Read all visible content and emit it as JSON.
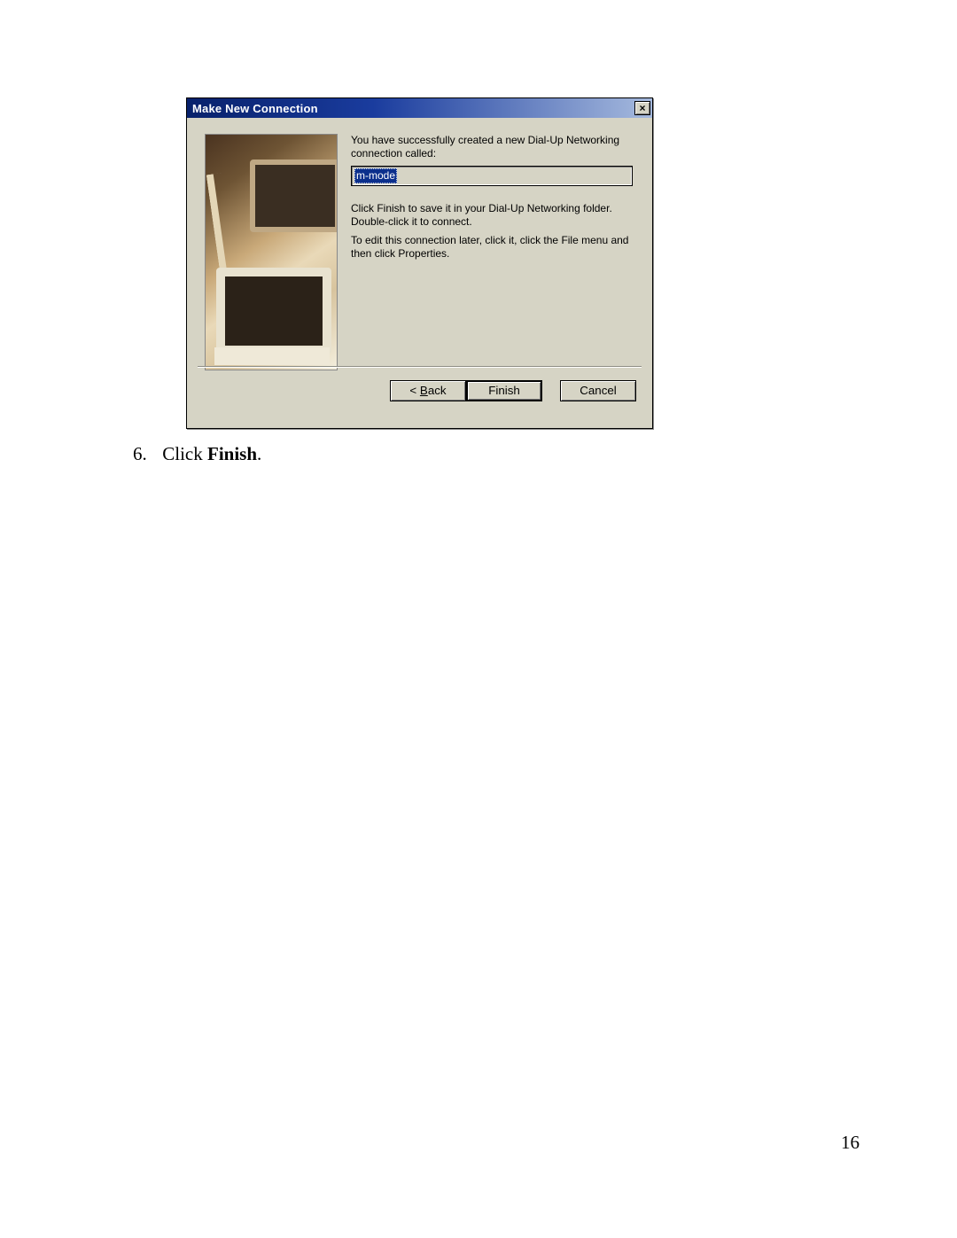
{
  "dialog": {
    "title": "Make New Connection",
    "close_label": "×",
    "text1": "You have successfully created a new Dial-Up Networking connection called:",
    "connection_name": "m-mode",
    "text2": "Click Finish to save it in your Dial-Up Networking folder. Double-click it to connect.",
    "text3": "To edit this connection later, click it, click the File menu and then click Properties.",
    "buttons": {
      "back_prefix": "< ",
      "back_u": "B",
      "back_rest": "ack",
      "finish": "Finish",
      "cancel": "Cancel"
    }
  },
  "step": {
    "num": "6.",
    "pre": "Click ",
    "bold": "Finish",
    "post": "."
  },
  "page_number": "16"
}
